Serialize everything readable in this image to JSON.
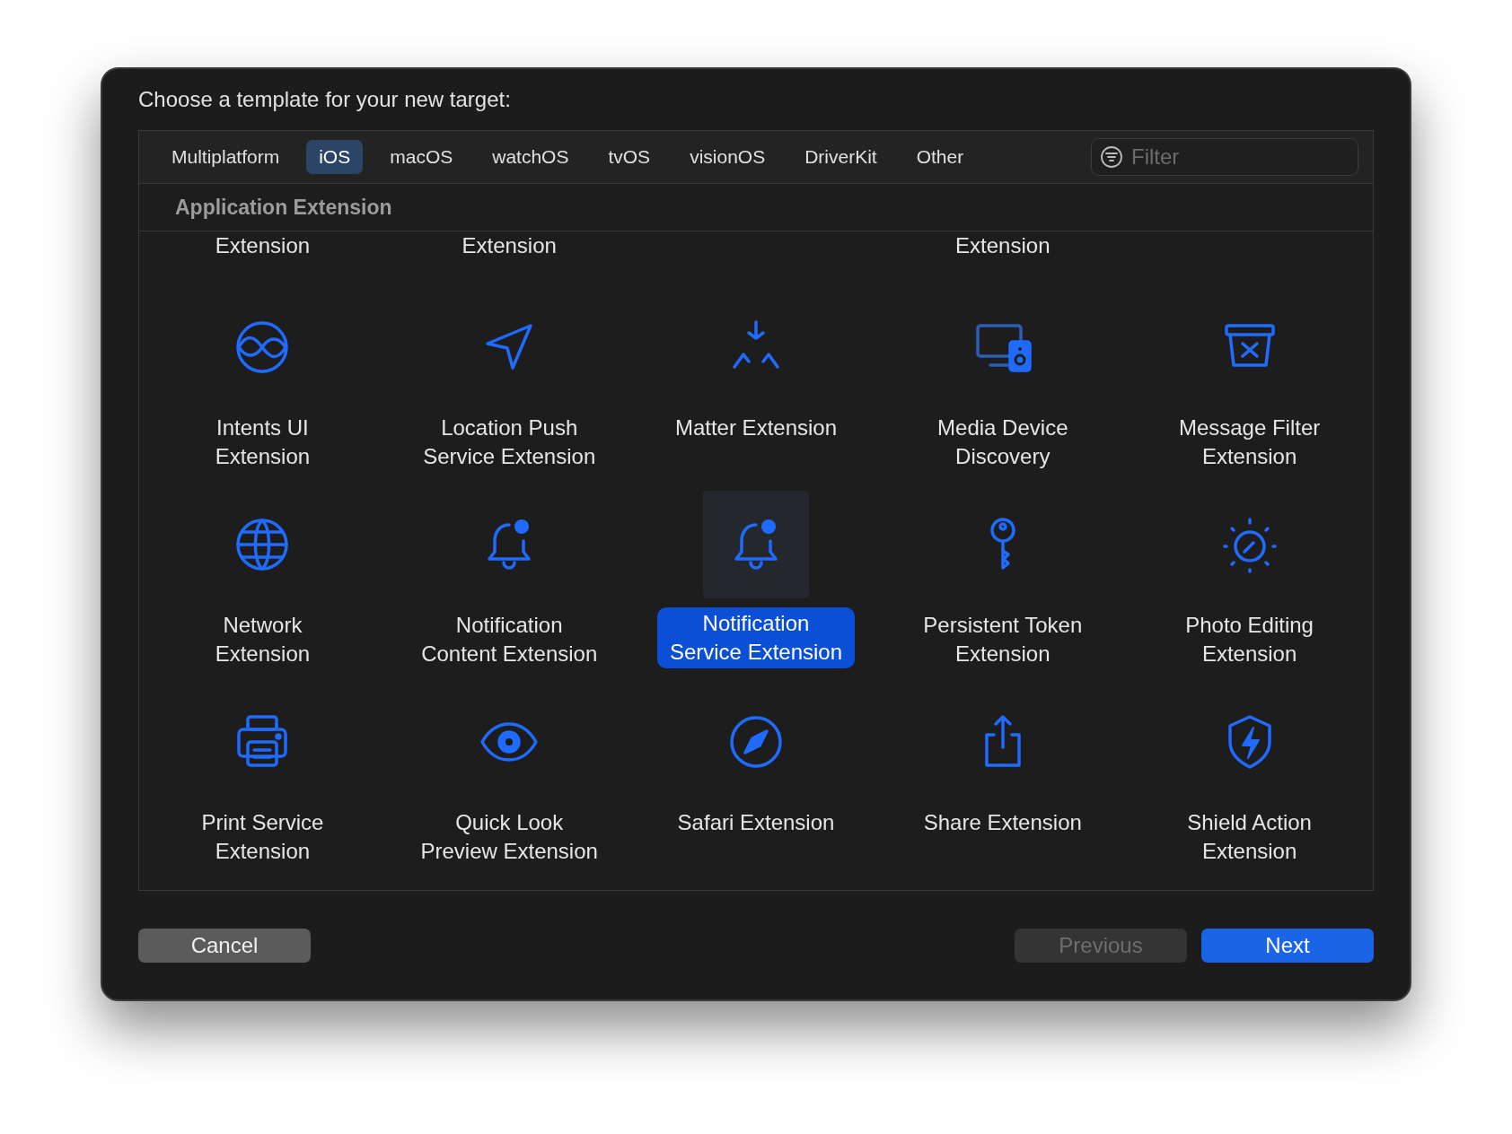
{
  "dialog": {
    "title": "Choose a template for your new target:"
  },
  "tabs": [
    {
      "label": "Multiplatform",
      "selected": false
    },
    {
      "label": "iOS",
      "selected": true
    },
    {
      "label": "macOS",
      "selected": false
    },
    {
      "label": "watchOS",
      "selected": false
    },
    {
      "label": "tvOS",
      "selected": false
    },
    {
      "label": "visionOS",
      "selected": false
    },
    {
      "label": "DriverKit",
      "selected": false
    },
    {
      "label": "Other",
      "selected": false
    }
  ],
  "filter": {
    "placeholder": "Filter"
  },
  "section": {
    "title": "Application Extension"
  },
  "partial_row": [
    {
      "kind": "text",
      "label": "Extension"
    },
    {
      "kind": "text",
      "label": "Extension"
    },
    {
      "kind": "blank"
    },
    {
      "kind": "text",
      "label": "Extension"
    },
    {
      "kind": "blank"
    }
  ],
  "templates": [
    {
      "label": "Intents UI\nExtension",
      "selected": false
    },
    {
      "label": "Location Push\nService Extension",
      "selected": false
    },
    {
      "label": "Matter Extension",
      "selected": false
    },
    {
      "label": "Media Device\nDiscovery",
      "selected": false
    },
    {
      "label": "Message Filter\nExtension",
      "selected": false
    },
    {
      "label": "Network\nExtension",
      "selected": false
    },
    {
      "label": "Notification\nContent Extension",
      "selected": false
    },
    {
      "label": "Notification\nService Extension",
      "selected": true
    },
    {
      "label": "Persistent Token\nExtension",
      "selected": false
    },
    {
      "label": "Photo Editing\nExtension",
      "selected": false
    },
    {
      "label": "Print Service\nExtension",
      "selected": false
    },
    {
      "label": "Quick Look\nPreview Extension",
      "selected": false
    },
    {
      "label": "Safari Extension",
      "selected": false
    },
    {
      "label": "Share Extension",
      "selected": false
    },
    {
      "label": "Shield Action\nExtension",
      "selected": false
    }
  ],
  "buttons": [
    {
      "label": "Cancel",
      "kind": "normal",
      "disabled": false
    },
    {
      "label": "Previous",
      "kind": "normal",
      "disabled": true
    },
    {
      "label": "Next",
      "kind": "primary",
      "disabled": false
    }
  ]
}
